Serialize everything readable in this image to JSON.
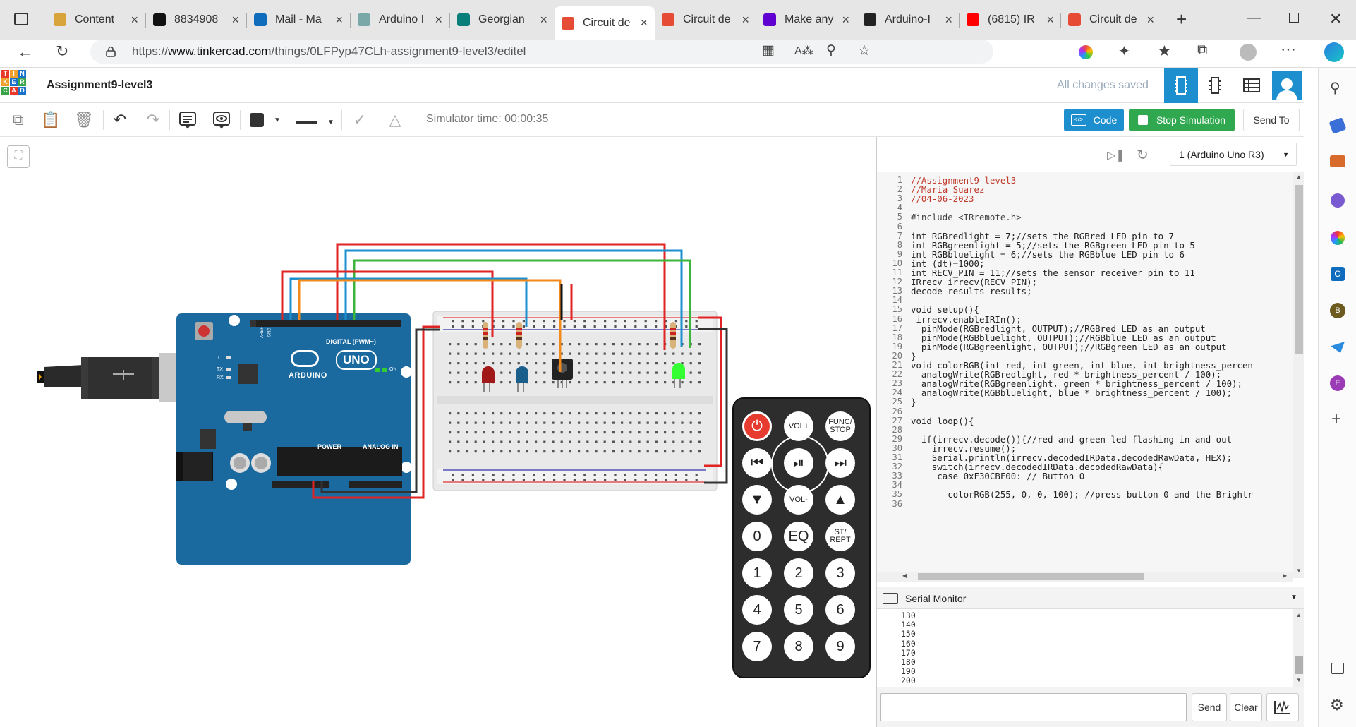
{
  "browser": {
    "tabs": [
      {
        "title": "Content",
        "icon": "pencil-note-icon",
        "color": "#d7a53c"
      },
      {
        "title": "8834908",
        "icon": "blackboard-icon",
        "color": "#111111"
      },
      {
        "title": "Mail - Ma",
        "icon": "outlook-icon",
        "color": "#0f6cbd"
      },
      {
        "title": "Arduino I",
        "icon": "arduino-icon",
        "color": "#7aa7a7"
      },
      {
        "title": "Georgian",
        "icon": "sharepoint-icon",
        "color": "#0a7f7a"
      },
      {
        "title": "Circuit de",
        "icon": "tinkercad-icon",
        "color": "#e54b35",
        "active": true
      },
      {
        "title": "Circuit de",
        "icon": "tinkercad-icon",
        "color": "#e54b35"
      },
      {
        "title": "Make any",
        "icon": "yahoo-icon",
        "color": "#5f01d1"
      },
      {
        "title": "Arduino-I",
        "icon": "github-icon",
        "color": "#222222"
      },
      {
        "title": "(6815) IR",
        "icon": "youtube-icon",
        "color": "#ff0000"
      },
      {
        "title": "Circuit de",
        "icon": "tinkercad-icon",
        "color": "#e54b35"
      }
    ],
    "url": "https://www.tinkercad.com/things/0LFPyp47CLh-assignment9-level3/editel",
    "url_parts": {
      "prefix": "https://",
      "host": "www.tinkercad.com",
      "path": "/things/0LFPyp47CLh-assignment9-level3/editel"
    }
  },
  "tinkercad": {
    "logo_letters": [
      "T",
      "I",
      "N",
      "K",
      "E",
      "R",
      "C",
      "A",
      "D"
    ],
    "project_title": "Assignment9-level3",
    "save_status": "All changes saved",
    "simulator_time": "Simulator time: 00:00:35",
    "buttons": {
      "code": "Code",
      "stop": "Stop Simulation",
      "send_to": "Send To"
    },
    "accent": "#1d8fcf",
    "stop_color": "#2fa84f"
  },
  "code_panel": {
    "device_select": "1 (Arduino Uno R3)",
    "lines": [
      {
        "n": "1",
        "text": "//Assignment9-level3",
        "cls": "cm"
      },
      {
        "n": "2",
        "text": "//Maria Suarez",
        "cls": "cm"
      },
      {
        "n": "3",
        "text": "//04-06-2023",
        "cls": "cm"
      },
      {
        "n": "4",
        "text": "",
        "cls": ""
      },
      {
        "n": "5",
        "text": "#include <IRremote.h>",
        "cls": "pp"
      },
      {
        "n": "6",
        "text": "",
        "cls": ""
      },
      {
        "n": "7",
        "text": "int RGBredlight = 7;//sets the RGBred LED pin to 7",
        "cls": ""
      },
      {
        "n": "8",
        "text": "int RGBgreenlight = 5;//sets the RGBgreen LED pin to 5",
        "cls": ""
      },
      {
        "n": "9",
        "text": "int RGBbluelight = 6;//sets the RGBblue LED pin to 6",
        "cls": ""
      },
      {
        "n": "10",
        "text": "int (dt)=1000;",
        "cls": ""
      },
      {
        "n": "11",
        "text": "int RECV_PIN = 11;//sets the sensor receiver pin to 11",
        "cls": ""
      },
      {
        "n": "12",
        "text": "IRrecv irrecv(RECV_PIN);",
        "cls": ""
      },
      {
        "n": "13",
        "text": "decode_results results;",
        "cls": ""
      },
      {
        "n": "14",
        "text": "",
        "cls": ""
      },
      {
        "n": "15",
        "text": "void setup(){",
        "cls": ""
      },
      {
        "n": "16",
        "text": " irrecv.enableIRIn();",
        "cls": ""
      },
      {
        "n": "17",
        "text": "  pinMode(RGBredlight, OUTPUT);//RGBred LED as an output",
        "cls": ""
      },
      {
        "n": "18",
        "text": "  pinMode(RGBbluelight, OUTPUT);//RGBblue LED as an output",
        "cls": ""
      },
      {
        "n": "19",
        "text": "  pinMode(RGBgreenlight, OUTPUT);//RGBgreen LED as an output",
        "cls": ""
      },
      {
        "n": "20",
        "text": "}",
        "cls": ""
      },
      {
        "n": "21",
        "text": "void colorRGB(int red, int green, int blue, int brightness_percen",
        "cls": ""
      },
      {
        "n": "22",
        "text": "  analogWrite(RGBredlight, red * brightness_percent / 100);",
        "cls": ""
      },
      {
        "n": "23",
        "text": "  analogWrite(RGBgreenlight, green * brightness_percent / 100);",
        "cls": ""
      },
      {
        "n": "24",
        "text": "  analogWrite(RGBbluelight, blue * brightness_percent / 100);",
        "cls": ""
      },
      {
        "n": "25",
        "text": "}",
        "cls": ""
      },
      {
        "n": "26",
        "text": "",
        "cls": ""
      },
      {
        "n": "27",
        "text": "void loop(){",
        "cls": ""
      },
      {
        "n": "28",
        "text": "",
        "cls": ""
      },
      {
        "n": "29",
        "text": "  if(irrecv.decode()){//red and green led flashing in and out",
        "cls": ""
      },
      {
        "n": "30",
        "text": "    irrecv.resume();",
        "cls": ""
      },
      {
        "n": "31",
        "text": "    Serial.println(irrecv.decodedIRData.decodedRawData, HEX);",
        "cls": ""
      },
      {
        "n": "32",
        "text": "    switch(irrecv.decodedIRData.decodedRawData){",
        "cls": ""
      },
      {
        "n": "33",
        "text": "     case 0xF30CBF00: // Button 0",
        "cls": ""
      },
      {
        "n": "34",
        "text": "",
        "cls": ""
      },
      {
        "n": "35",
        "text": "       colorRGB(255, 0, 0, 100); //press button 0 and the Brightr",
        "cls": ""
      },
      {
        "n": "36",
        "text": "",
        "cls": ""
      }
    ],
    "serial_monitor_label": "Serial Monitor",
    "serial_lines": [
      "130",
      "140",
      "150",
      "160",
      "170",
      "180",
      "190",
      "200"
    ],
    "send_label": "Send",
    "clear_label": "Clear"
  },
  "arduino": {
    "brand": "ARDUINO",
    "model": "UNO",
    "digital_label": "DIGITAL (PWM~)",
    "power_label": "POWER",
    "analog_label": "ANALOG IN",
    "on_label": "ON",
    "tx_label": "TX",
    "rx_label": "RX",
    "l_label": "L",
    "aref_label": "AREF",
    "gnd_label": "GND"
  },
  "remote": {
    "buttons": [
      {
        "label": "",
        "name": "remote-power-button",
        "icon": "power-icon"
      },
      {
        "label": "VOL+",
        "name": "remote-vol-up-button"
      },
      {
        "label": "FUNC/ STOP",
        "name": "remote-func-stop-button"
      },
      {
        "label": "",
        "name": "remote-rewind-button",
        "icon": "rewind-icon"
      },
      {
        "label": "",
        "name": "remote-play-pause-button",
        "icon": "play-pause-icon"
      },
      {
        "label": "",
        "name": "remote-forward-button",
        "icon": "fast-forward-icon"
      },
      {
        "label": "",
        "name": "remote-down-button",
        "icon": "down-arrow-icon"
      },
      {
        "label": "VOL-",
        "name": "remote-vol-down-button"
      },
      {
        "label": "",
        "name": "remote-up-button",
        "icon": "up-arrow-icon"
      },
      {
        "label": "0",
        "name": "remote-button-0"
      },
      {
        "label": "EQ",
        "name": "remote-eq-button"
      },
      {
        "label": "ST/ REPT",
        "name": "remote-st-rept-button"
      },
      {
        "label": "1",
        "name": "remote-button-1"
      },
      {
        "label": "2",
        "name": "remote-button-2"
      },
      {
        "label": "3",
        "name": "remote-button-3"
      },
      {
        "label": "4",
        "name": "remote-button-4"
      },
      {
        "label": "5",
        "name": "remote-button-5"
      },
      {
        "label": "6",
        "name": "remote-button-6"
      },
      {
        "label": "7",
        "name": "remote-button-7"
      },
      {
        "label": "8",
        "name": "remote-button-8"
      },
      {
        "label": "9",
        "name": "remote-button-9"
      }
    ]
  }
}
